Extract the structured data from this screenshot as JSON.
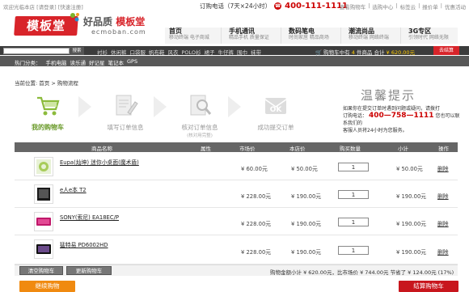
{
  "topbar": {
    "welcome": "欢迎光临本店",
    "login": "[请登录]",
    "register": "[快速注册]",
    "hotline_label": "订购电话（7天×24小时）",
    "hotline": "400-111-1111",
    "links": [
      "查看购物车",
      "|",
      "选购中心",
      "|",
      "标签云",
      "|",
      "报价单",
      "|",
      "优惠活动"
    ]
  },
  "header": {
    "logo": "模板堂",
    "slogan_a": "好品质",
    "slogan_b": "模板堂",
    "domain": "ecmoban.com"
  },
  "categories": [
    {
      "title": "首页",
      "sub": "移动终端  电子商城"
    },
    {
      "title": "手机通讯",
      "sub": "精品手机  质量保证"
    },
    {
      "title": "数码笔电",
      "sub": "时尚家居  精品商场"
    },
    {
      "title": "潮流尚品",
      "sub": "移动终端  网络终端"
    },
    {
      "title": "3G专区",
      "sub": "引领时代  网络无限"
    }
  ],
  "nav": {
    "search_button": "搜索",
    "links": [
      "衬衫",
      "休闲裤",
      "口袋服",
      "帆布鞋",
      "风衣",
      "POLO衫",
      "裙子",
      "牛仔裤",
      "围巾",
      "袜带"
    ],
    "cart_prefix": "购物车中有",
    "cart_count": "4",
    "cart_mid": "件商品 合计",
    "cart_amount": "¥ 620.00元",
    "checkout": "去结算"
  },
  "hot": {
    "label": "热门分类：",
    "links": [
      "手机电脑",
      "读乐通",
      "好记星",
      "笔记本",
      "GPS"
    ]
  },
  "breadcrumb": "当前位置: 首页 > 购物流程",
  "steps": [
    {
      "label": "我的购物车",
      "sub": ""
    },
    {
      "label": "填写订单信息",
      "sub": ""
    },
    {
      "label": "核对订单信息",
      "sub": "(核对用完整)"
    },
    {
      "label": "成功提交订单",
      "sub": ""
    }
  ],
  "tip": {
    "title": "温馨提示",
    "line1": "如果你在提交订单时遇到问题或疑问，请拨打",
    "tel_label": "订购电话：",
    "tel": "400—758—1111",
    "line2": "您也可以联系我们的",
    "line3": "客服人员将24小时为您服务。"
  },
  "table": {
    "headers": [
      "商品名称",
      "属性",
      "市场价",
      "本店价",
      "购买数量",
      "小计",
      "操作"
    ],
    "rows": [
      {
        "name": "Eupa(灿坤) 迷你小桌面(魔术盾)",
        "market": "¥ 60.00元",
        "shop": "¥ 50.00元",
        "qty": "1",
        "subtotal": "¥ 50.00元",
        "action": "删除"
      },
      {
        "name": "e人e本  T2",
        "market": "¥ 228.00元",
        "shop": "¥ 190.00元",
        "qty": "1",
        "subtotal": "¥ 190.00元",
        "action": "删除"
      },
      {
        "name": "SONY(索尼) EA18EC/P",
        "market": "¥ 228.00元",
        "shop": "¥ 190.00元",
        "qty": "1",
        "subtotal": "¥ 190.00元",
        "action": "删除"
      },
      {
        "name": "猛特易  PD6002HD",
        "market": "¥ 228.00元",
        "shop": "¥ 190.00元",
        "qty": "1",
        "subtotal": "¥ 190.00元",
        "action": "删除"
      }
    ]
  },
  "footer": {
    "clear": "清空购物车",
    "update": "更新购物车",
    "totals": "购物金额小计 ¥ 620.00元，比市场价 ¥ 744.00元 节省了 ¥ 124.00元 (17%)"
  },
  "actions": {
    "continue": "继续购物",
    "checkout": "结算购物车"
  },
  "colors": {
    "brand_red": "#d8242a",
    "green_active": "#6a9a2a",
    "orange": "#f08a10"
  }
}
